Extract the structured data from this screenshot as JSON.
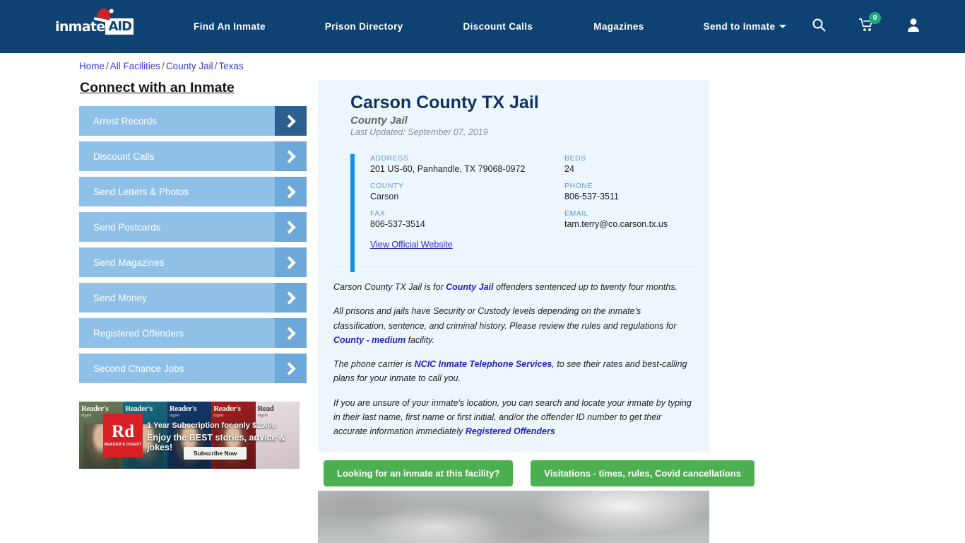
{
  "header": {
    "logo": {
      "word": "inmate",
      "badge": "AID",
      "hat_icon": "santa-hat-icon"
    },
    "nav": [
      {
        "label": "Find An Inmate"
      },
      {
        "label": "Prison Directory"
      },
      {
        "label": "Discount Calls"
      },
      {
        "label": "Magazines"
      },
      {
        "label": "Send to Inmate",
        "has_dropdown": true
      }
    ],
    "icons": {
      "search": "search-icon",
      "cart": "shopping-cart-icon",
      "cart_count": "0",
      "account": "user-account-icon"
    },
    "colors": {
      "background": "#0e4273",
      "badge_green": "#1faa7a"
    }
  },
  "breadcrumb": {
    "items": [
      "Home",
      "All Facilities",
      "County Jail",
      "Texas"
    ],
    "separator": "/"
  },
  "sidebar": {
    "title": "Connect with an Inmate",
    "items": [
      {
        "label": "Arrest Records",
        "active": true
      },
      {
        "label": "Discount Calls",
        "active": false
      },
      {
        "label": "Send Letters & Photos",
        "active": false
      },
      {
        "label": "Send Postcards",
        "active": false
      },
      {
        "label": "Send Magazines",
        "active": false
      },
      {
        "label": "Send Money",
        "active": false
      },
      {
        "label": "Registered Offenders",
        "active": false
      },
      {
        "label": "Second Chance Jobs",
        "active": false
      }
    ]
  },
  "ad": {
    "brand": "Reader's Digest",
    "logo_mark": "Rd",
    "logo_sub": "READER'S DIGEST",
    "line1": "1 Year Subscription for only $19.98",
    "line2": "Enjoy the BEST stories, advice & jokes!",
    "cta": "Subscribe Now",
    "covers": [
      {
        "head": "Reader's",
        "sub": "digest"
      },
      {
        "head": "Reader's",
        "sub": "digest"
      },
      {
        "head": "Reader's",
        "sub": "digest"
      },
      {
        "head": "Reader's",
        "sub": "digest"
      },
      {
        "head": "Read",
        "sub": "digest"
      }
    ]
  },
  "facility": {
    "title": "Carson County TX Jail",
    "subtitle": "County Jail",
    "last_updated": "Last Updated: September 07, 2019",
    "details": [
      {
        "label": "ADDRESS",
        "value": "201 US-60, Panhandle, TX 79068-0972"
      },
      {
        "label": "BEDS",
        "value": "24"
      },
      {
        "label": "COUNTY",
        "value": "Carson"
      },
      {
        "label": "PHONE",
        "value": "806-537-3511"
      },
      {
        "label": "FAX",
        "value": "806-537-3514"
      },
      {
        "label": "EMAIL",
        "value": "tam.terry@co.carson.tx.us"
      }
    ],
    "official_website_link": "View Official Website",
    "paragraphs": {
      "p1_a": "Carson County TX Jail is for ",
      "p1_link": "County Jail",
      "p1_b": " offenders sentenced up to twenty four months.",
      "p2_a": "All prisons and jails have Security or Custody levels depending on the inmate's classification, sentence, and criminal history. Please review the rules and regulations for ",
      "p2_link": "County - medium",
      "p2_b": " facility.",
      "p3_a": "The phone carrier is ",
      "p3_link": "NCIC Inmate Telephone Services",
      "p3_b": ", to see their rates and best-calling plans for your inmate to call you.",
      "p4_a": "If you are unsure of your inmate's location, you can search and locate your inmate by typing in their last name, first name or first initial, and/or the offender ID number to get their accurate information immediately ",
      "p4_link": "Registered Offenders"
    }
  },
  "cta_buttons": [
    {
      "label": "Looking for an inmate at this facility?"
    },
    {
      "label": "Visitations - times, rules, Covid cancellations"
    }
  ],
  "photo": {
    "alt": "cloudy-sky-facility-photo"
  }
}
